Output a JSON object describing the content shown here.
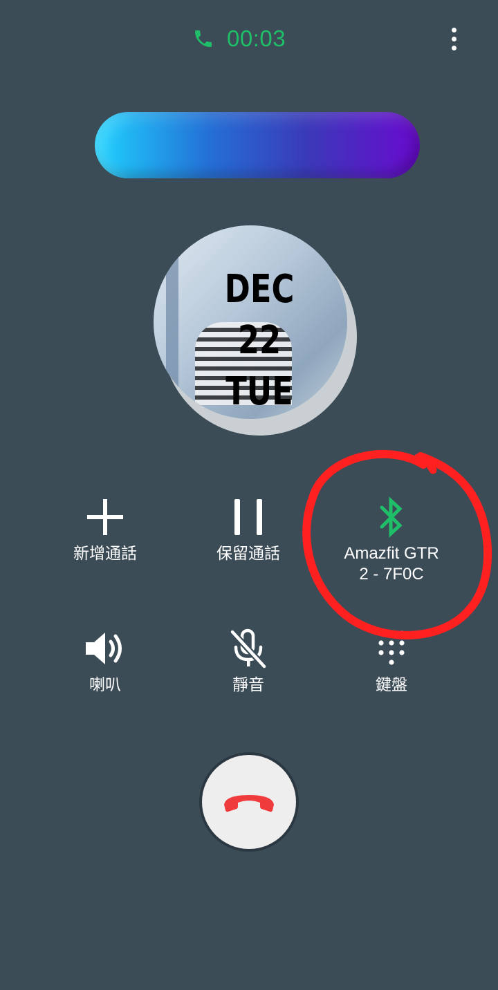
{
  "call": {
    "elapsed": "00:03"
  },
  "contact": {
    "date_lines": [
      "DEC",
      "22",
      "TUE"
    ]
  },
  "controls": {
    "add_call": "新增通話",
    "hold": "保留通話",
    "bluetooth_line1": "Amazfit GTR",
    "bluetooth_line2": "2 - 7F0C",
    "speaker": "喇叭",
    "mute": "靜音",
    "keypad": "鍵盤"
  },
  "colors": {
    "background": "#3c4c57",
    "accent_green": "#1fbf6a",
    "end_call_red": "#ef3b3b",
    "annotation_red": "#ff2020"
  },
  "icons": {
    "timer": "phone-icon",
    "menu": "more-vertical-icon",
    "add_call": "plus-icon",
    "hold": "pause-icon",
    "bluetooth": "bluetooth-icon",
    "speaker": "speaker-icon",
    "mute": "mic-off-icon",
    "keypad": "dialpad-icon",
    "end_call": "hang-up-icon"
  }
}
